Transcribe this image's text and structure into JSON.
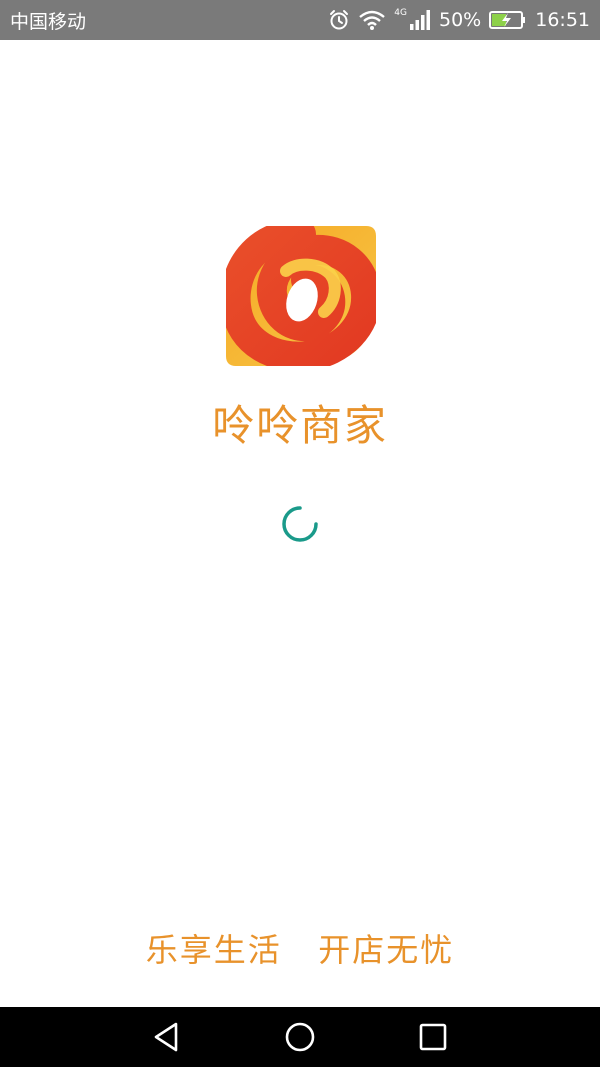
{
  "status_bar": {
    "carrier": "中国移动",
    "network": "4G",
    "battery_percent": "50%",
    "time": "16:51",
    "icons": [
      "alarm-icon",
      "wifi-icon",
      "signal-icon",
      "battery-charging-icon"
    ]
  },
  "splash": {
    "app_name": "呤呤商家",
    "slogan": "乐享生活   开店无忧",
    "loading": true
  },
  "colors": {
    "brand_orange": "#e8922b",
    "logo_red": "#e5472a",
    "logo_yellow": "#f7b52c",
    "spinner": "#1a9a8a",
    "status_bar_bg": "#7a7a7a",
    "nav_bar_bg": "#000000"
  },
  "nav_bar": {
    "buttons": [
      "back-icon",
      "home-icon",
      "recent-apps-icon"
    ]
  }
}
